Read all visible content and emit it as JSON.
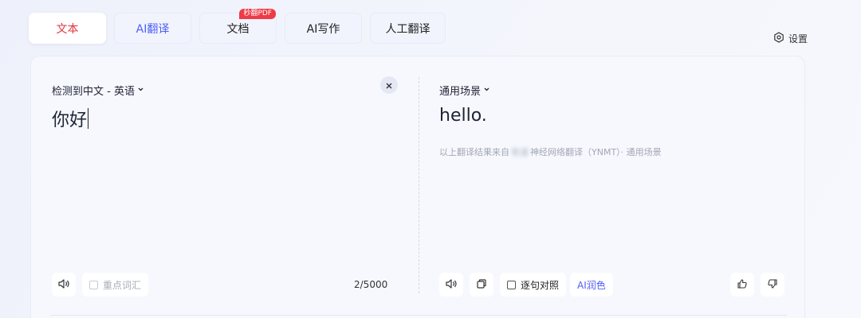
{
  "tabs": [
    {
      "label": "文本"
    },
    {
      "label": "AI翻译"
    },
    {
      "label": "文档",
      "badge": "秒翻PDF"
    },
    {
      "label": "AI写作"
    },
    {
      "label": "人工翻译"
    }
  ],
  "settings_label": "设置",
  "source": {
    "lang_label": "检测到中文 - 英语",
    "text": "你好",
    "key_words_label": "重点词汇",
    "char_count": "2/5000"
  },
  "target": {
    "scene_label": "通用场景",
    "text": "hello.",
    "note_prefix": "以上翻译结果来自",
    "note_blurred": "有道",
    "note_suffix": "神经网络翻译（YNMT）· 通用场景",
    "compare_label": "逐句对照",
    "polish_label": "AI润色"
  },
  "colors": {
    "accent_red": "#e2343b",
    "accent_blue": "#4e5ef5",
    "badge_red": "#ee3b46"
  }
}
